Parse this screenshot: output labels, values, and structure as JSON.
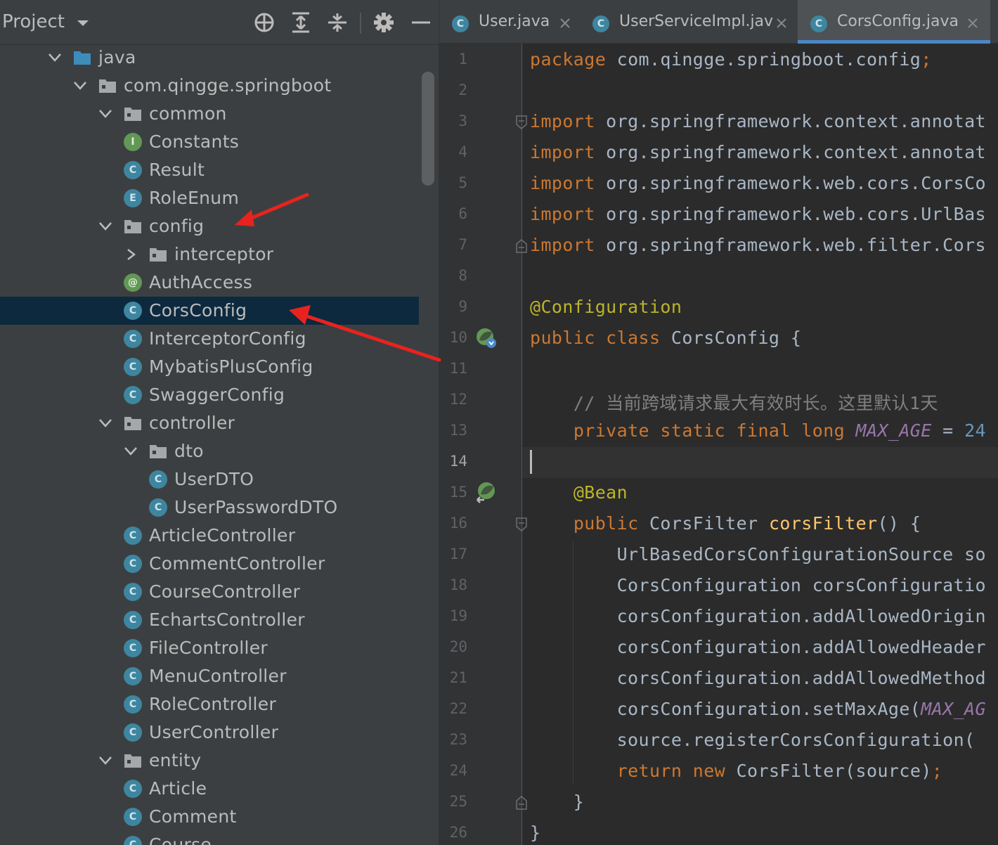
{
  "project_panel": {
    "title": "Project",
    "tree": [
      {
        "label": "java",
        "type": "source-folder",
        "depth": 0,
        "expanded": true
      },
      {
        "label": "com.qingge.springboot",
        "type": "package",
        "depth": 1,
        "expanded": true
      },
      {
        "label": "common",
        "type": "folder",
        "depth": 2,
        "expanded": true
      },
      {
        "label": "Constants",
        "type": "interface",
        "depth": 3
      },
      {
        "label": "Result",
        "type": "class",
        "depth": 3
      },
      {
        "label": "RoleEnum",
        "type": "enum",
        "depth": 3
      },
      {
        "label": "config",
        "type": "folder",
        "depth": 2,
        "expanded": true
      },
      {
        "label": "interceptor",
        "type": "folder",
        "depth": 3,
        "expanded": false
      },
      {
        "label": "AuthAccess",
        "type": "annotation",
        "depth": 3
      },
      {
        "label": "CorsConfig",
        "type": "class",
        "depth": 3,
        "selected": true
      },
      {
        "label": "InterceptorConfig",
        "type": "class",
        "depth": 3
      },
      {
        "label": "MybatisPlusConfig",
        "type": "class",
        "depth": 3
      },
      {
        "label": "SwaggerConfig",
        "type": "class",
        "depth": 3
      },
      {
        "label": "controller",
        "type": "folder",
        "depth": 2,
        "expanded": true
      },
      {
        "label": "dto",
        "type": "folder",
        "depth": 3,
        "expanded": true
      },
      {
        "label": "UserDTO",
        "type": "class",
        "depth": 4
      },
      {
        "label": "UserPasswordDTO",
        "type": "class",
        "depth": 4
      },
      {
        "label": "ArticleController",
        "type": "class",
        "depth": 3
      },
      {
        "label": "CommentController",
        "type": "class",
        "depth": 3
      },
      {
        "label": "CourseController",
        "type": "class",
        "depth": 3
      },
      {
        "label": "EchartsController",
        "type": "class",
        "depth": 3
      },
      {
        "label": "FileController",
        "type": "class",
        "depth": 3
      },
      {
        "label": "MenuController",
        "type": "class",
        "depth": 3
      },
      {
        "label": "RoleController",
        "type": "class",
        "depth": 3
      },
      {
        "label": "UserController",
        "type": "class",
        "depth": 3
      },
      {
        "label": "entity",
        "type": "folder",
        "depth": 2,
        "expanded": true
      },
      {
        "label": "Article",
        "type": "class",
        "depth": 3
      },
      {
        "label": "Comment",
        "type": "class",
        "depth": 3
      },
      {
        "label": "Course",
        "type": "class",
        "depth": 3
      }
    ]
  },
  "editor": {
    "tabs": [
      {
        "label": "User.java",
        "active": false
      },
      {
        "label": "UserServiceImpl.jav",
        "active": false
      },
      {
        "label": "CorsConfig.java",
        "active": true
      }
    ],
    "current_line": 14,
    "lines": [
      [
        [
          "kw",
          "package "
        ],
        [
          "p",
          "com.qingge.springboot.config"
        ],
        [
          "kw",
          ";"
        ]
      ],
      [],
      [
        [
          "kw",
          "import "
        ],
        [
          "p",
          "org.springframework.context.annotat"
        ]
      ],
      [
        [
          "kw",
          "import "
        ],
        [
          "p",
          "org.springframework.context.annotat"
        ]
      ],
      [
        [
          "kw",
          "import "
        ],
        [
          "p",
          "org.springframework.web.cors.CorsCo"
        ]
      ],
      [
        [
          "kw",
          "import "
        ],
        [
          "p",
          "org.springframework.web.cors.UrlBas"
        ]
      ],
      [
        [
          "kw",
          "import "
        ],
        [
          "p",
          "org.springframework.web.filter.Cors"
        ]
      ],
      [],
      [
        [
          "ann",
          "@Configuration"
        ]
      ],
      [
        [
          "kw",
          "public class "
        ],
        [
          "p",
          "CorsConfig {"
        ]
      ],
      [],
      [
        [
          "p",
          "    "
        ],
        [
          "cmt",
          "// 当前跨域请求最大有效时长。这里默认1天"
        ]
      ],
      [
        [
          "p",
          "    "
        ],
        [
          "kw",
          "private static final long "
        ],
        [
          "const",
          "MAX_AGE"
        ],
        [
          "p",
          " = "
        ],
        [
          "num",
          "24"
        ]
      ],
      [],
      [
        [
          "p",
          "    "
        ],
        [
          "ann",
          "@Bean"
        ]
      ],
      [
        [
          "p",
          "    "
        ],
        [
          "kw",
          "public "
        ],
        [
          "p",
          "CorsFilter "
        ],
        [
          "fn",
          "corsFilter"
        ],
        [
          "p",
          "() {"
        ]
      ],
      [
        [
          "p",
          "        UrlBasedCorsConfigurationSource so"
        ]
      ],
      [
        [
          "p",
          "        CorsConfiguration corsConfiguratio"
        ]
      ],
      [
        [
          "p",
          "        corsConfiguration.addAllowedOrigin"
        ]
      ],
      [
        [
          "p",
          "        corsConfiguration.addAllowedHeader"
        ]
      ],
      [
        [
          "p",
          "        corsConfiguration.addAllowedMethod"
        ]
      ],
      [
        [
          "p",
          "        corsConfiguration.setMaxAge("
        ],
        [
          "const",
          "MAX_AG"
        ]
      ],
      [
        [
          "p",
          "        source.registerCorsConfiguration("
        ]
      ],
      [
        [
          "p",
          "        "
        ],
        [
          "kw",
          "return new "
        ],
        [
          "p",
          "CorsFilter(source)"
        ],
        [
          "kw",
          ";"
        ]
      ],
      [
        [
          "p",
          "    }"
        ]
      ],
      [
        [
          "p",
          "}"
        ]
      ]
    ]
  },
  "icons": {
    "dropdown": "chevron-down-icon",
    "locate": "crosshair-icon",
    "expand_all": "expand-all-icon",
    "collapse_all": "collapse-all-icon",
    "settings": "gear-icon",
    "hide": "minimize-icon"
  },
  "colors": {
    "selection": "#0d293e",
    "keyword": "#cc7832",
    "annotation": "#bbb529",
    "annotation_arrow": "#e8231f",
    "active_tab_underline": "#4a88c7"
  }
}
